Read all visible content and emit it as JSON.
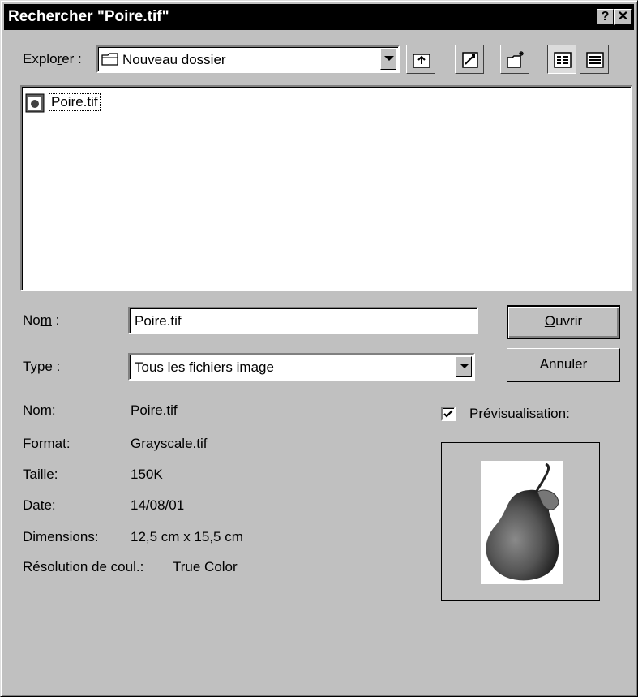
{
  "window": {
    "title": "Rechercher \"Poire.tif\"",
    "help_glyph": "?",
    "close_glyph": "✕"
  },
  "explorer": {
    "label_pre": "Explo",
    "label_accel": "r",
    "label_post": "er :",
    "folder_value": "Nouveau dossier"
  },
  "toolbar_icons": [
    "up-folder-icon",
    "favorites-icon",
    "new-folder-icon",
    "list-view-icon",
    "details-view-icon"
  ],
  "file_list": {
    "items": [
      {
        "name": "Poire.tif",
        "icon": "tif-file-icon"
      }
    ]
  },
  "name_field": {
    "label_pre": "No",
    "label_accel": "m",
    "label_post": " :",
    "value": "Poire.tif"
  },
  "type_field": {
    "label_accel": "T",
    "label_post": "ype :",
    "value": "Tous les fichiers image"
  },
  "buttons": {
    "open_accel": "O",
    "open_rest": "uvrir",
    "cancel": "Annuler"
  },
  "info": {
    "rows": [
      {
        "label": "Nom:",
        "value": "Poire.tif"
      },
      {
        "label": "Format:",
        "value": "Grayscale.tif"
      },
      {
        "label": "Taille:",
        "value": "150K"
      },
      {
        "label": "Date:",
        "value": "14/08/01"
      },
      {
        "label": "Dimensions:",
        "value": "12,5 cm x 15,5 cm"
      }
    ],
    "resolution_label": "Résolution de coul.:",
    "resolution_value": "True Color"
  },
  "preview": {
    "checked": true,
    "label_accel": "P",
    "label_rest": "révisualisation:"
  }
}
